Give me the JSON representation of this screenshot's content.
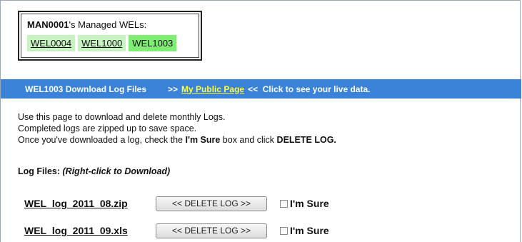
{
  "managed": {
    "owner": "MAN0001",
    "suffix": "'s Managed WELs:",
    "wels": [
      {
        "label": "WEL0004",
        "active": false
      },
      {
        "label": "WEL1000",
        "active": false
      },
      {
        "label": "WEL1003",
        "active": true
      }
    ]
  },
  "banner": {
    "title": "WEL1003 Download Log Files",
    "prefix": ">>",
    "public_link": "My Public Page",
    "suffix": "<<  Click to see your live data."
  },
  "intro": {
    "line1": "Use this page to download and delete monthly Logs.",
    "line2": "Completed logs are zipped up to save space.",
    "line3_start": "Once you've downloaded a log, check the ",
    "line3_bold1": "I'm Sure",
    "line3_mid": " box and click ",
    "line3_bold2": "DELETE LOG."
  },
  "log_files": {
    "heading": "Log Files:",
    "hint": "(Right-click to Download)",
    "delete_label": "<< DELETE LOG >>",
    "sure_label": "I'm Sure",
    "files": [
      "WEL_log_2011_08.zip",
      "WEL_log_2011_09.xls"
    ]
  },
  "colors": {
    "banner_bg": "#3b82d9",
    "banner_link": "#ffff3a",
    "wel_bg": "#c9f2c3",
    "wel_active_bg": "#7fec74"
  }
}
